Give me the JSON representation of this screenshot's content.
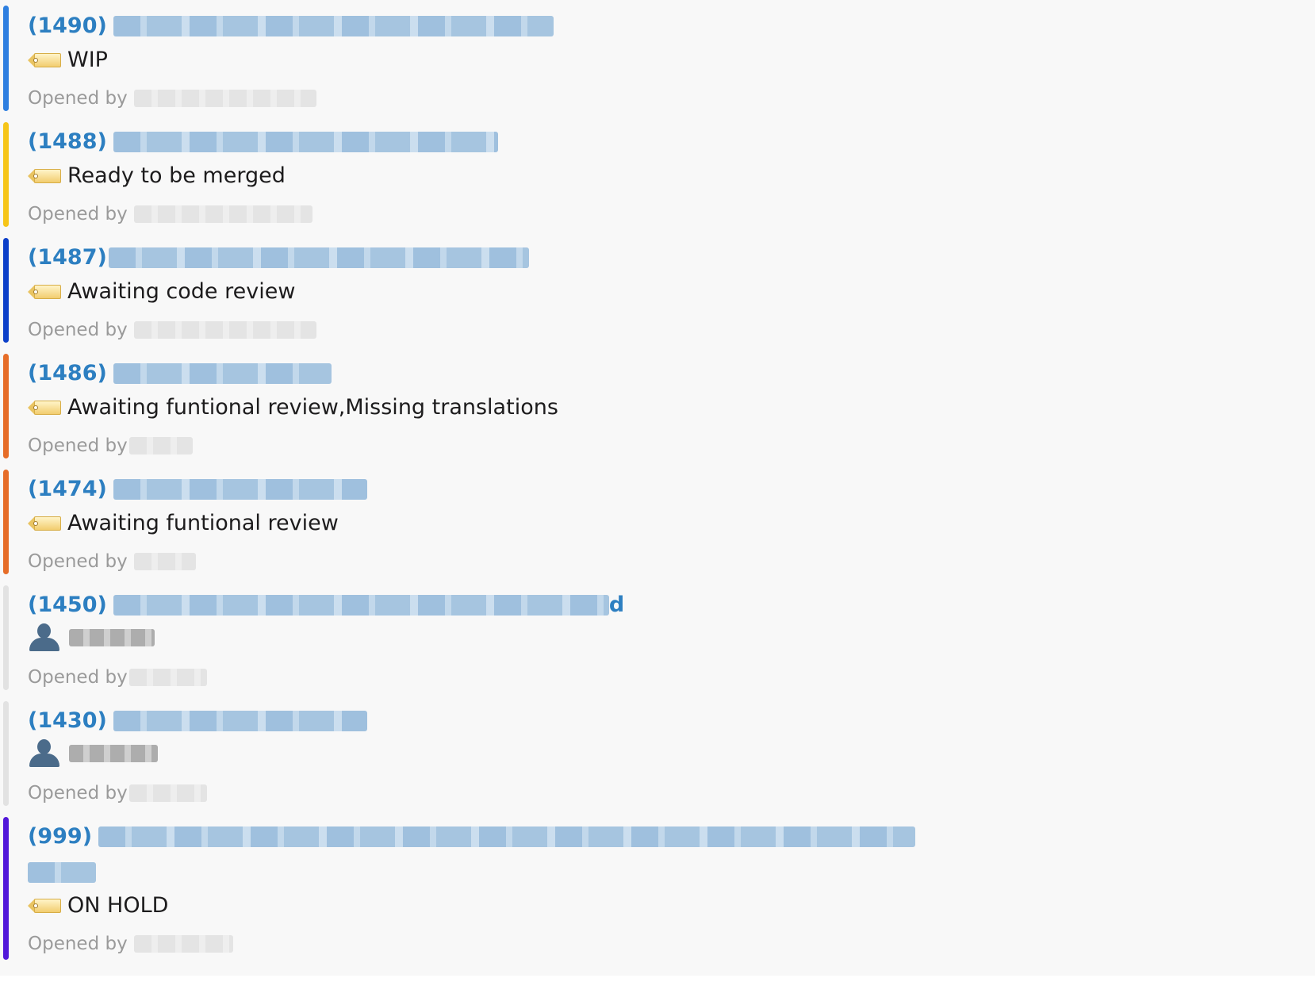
{
  "opened_by_label": "Opened by",
  "items": [
    {
      "number": "(1490)",
      "label": "WIP",
      "label_icon": "tag-icon",
      "color": "#2e7fe0"
    },
    {
      "number": "(1488)",
      "label": "Ready to be merged",
      "label_icon": "tag-icon",
      "color": "#f6c518"
    },
    {
      "number": "(1487)",
      "label": "Awaiting code review",
      "label_icon": "tag-icon",
      "color": "#0c3fc9"
    },
    {
      "number": "(1486)",
      "label": "Awaiting funtional review,Missing translations",
      "label_icon": "tag-icon",
      "color": "#e66d28"
    },
    {
      "number": "(1474)",
      "label": "Awaiting funtional review",
      "label_icon": "tag-icon",
      "color": "#e66d28"
    },
    {
      "number": "(1450)",
      "title_tail": "d",
      "label": "",
      "label_icon": "person-icon",
      "color": "#e2e2e2"
    },
    {
      "number": "(1430)",
      "label": "",
      "label_icon": "person-icon",
      "color": "#e2e2e2"
    },
    {
      "number": "(999)",
      "label": "ON HOLD",
      "label_icon": "tag-icon",
      "color": "#5217d9"
    }
  ]
}
